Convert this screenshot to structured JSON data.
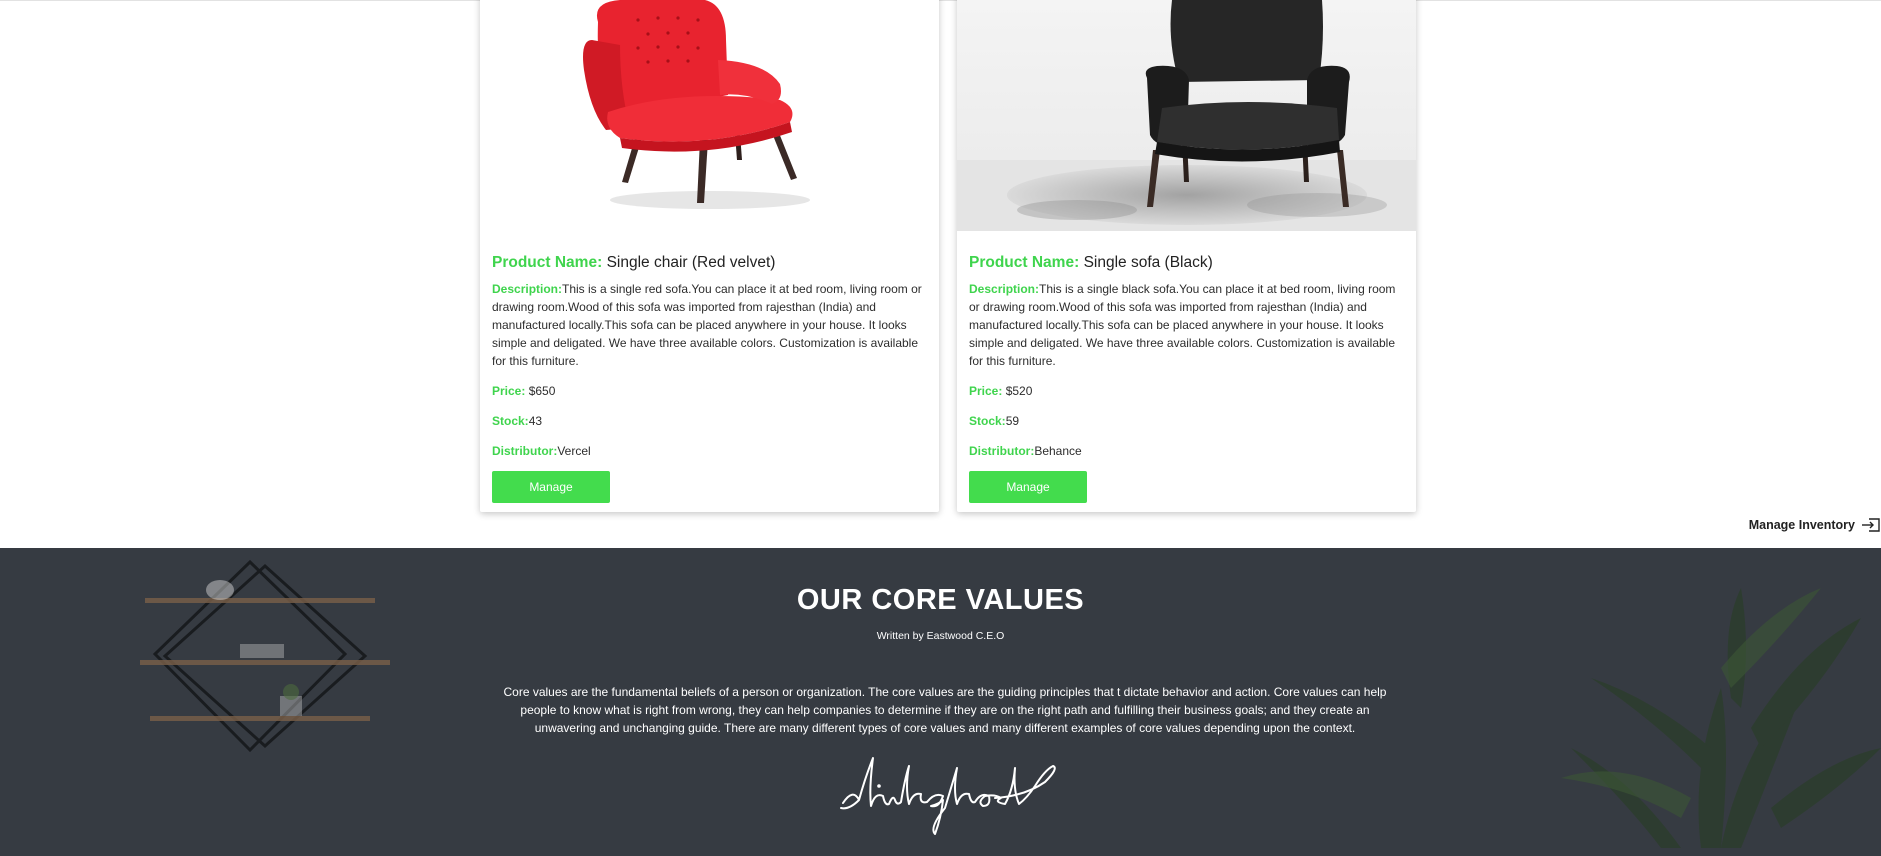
{
  "products": [
    {
      "name_label": "Product Name:",
      "name": "Single chair (Red velvet)",
      "description_label": "Description:",
      "description": "This is a single red sofa.You can place it at bed room, living room or drawing room.Wood of this sofa was imported from rajesthan (India) and manufactured locally.This sofa can be placed anywhere in your house. It looks simple and deligated. We have three available colors. Customization is available for this furniture.",
      "price_label": "Price:",
      "price": "$650",
      "stock_label": "Stock:",
      "stock": "43",
      "distributor_label": "Distributor:",
      "distributor": "Vercel",
      "button_label": "Manage",
      "image_icon": "red-armchair-image"
    },
    {
      "name_label": "Product Name:",
      "name": "Single sofa (Black)",
      "description_label": "Description:",
      "description": "This is a single black sofa.You can place it at bed room, living room or drawing room.Wood of this sofa was imported from rajesthan (India) and manufactured locally.This sofa can be placed anywhere in your house. It looks simple and deligated. We have three available colors. Customization is available for this furniture.",
      "price_label": "Price:",
      "price": "$520",
      "stock_label": "Stock:",
      "stock": "59",
      "distributor_label": "Distributor:",
      "distributor": "Behance",
      "button_label": "Manage",
      "image_icon": "black-armchair-image"
    }
  ],
  "manage_inventory": {
    "label": "Manage Inventory",
    "icon": "sign-in-icon"
  },
  "core_values": {
    "title": "OUR CORE VALUES",
    "subtitle": "Written by Eastwood C.E.O",
    "text": "Core values are the fundamental beliefs of a person or organization. The core values are the guiding principles that t dictate behavior and action. Core values can help people to know what is right from wrong, they can help companies to determine if they are on the right path and fulfilling their business goals; and they create an unwavering and unchanging guide. There are many different types of core values and many different examples of core values depending upon the context.",
    "signature": "shitghost"
  },
  "colors": {
    "accent": "#43dc4d",
    "label_green": "#3fd44d",
    "footer_bg": "#363b42"
  }
}
